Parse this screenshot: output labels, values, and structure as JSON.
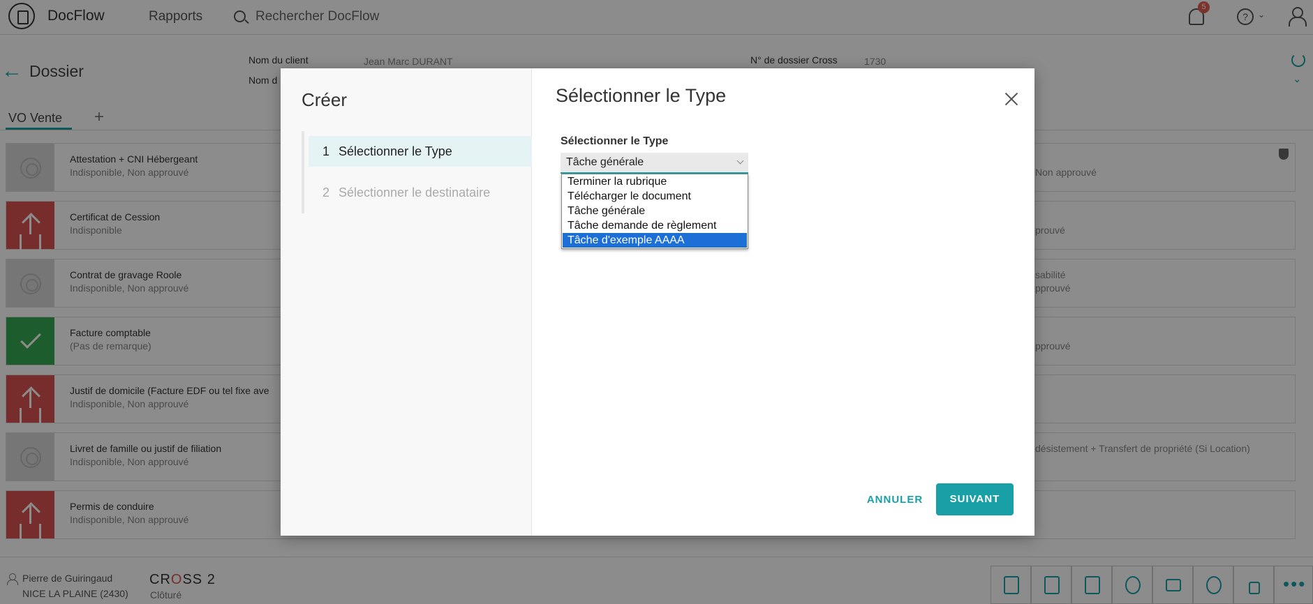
{
  "header": {
    "brand": "DocFlow",
    "nav_rapports": "Rapports",
    "search_placeholder": "Rechercher DocFlow",
    "notif_count": "5",
    "help": "?"
  },
  "dossier": {
    "title": "Dossier",
    "client_label": "Nom du client",
    "client_value": "Jean Marc DURANT",
    "second_label": "Nom d",
    "cross_label": "N° de dossier Cross",
    "cross_value": "1730"
  },
  "tabs": {
    "active": "VO Vente",
    "add": "+"
  },
  "rows": [
    {
      "title": "Attestation + CNI Hébergeant",
      "subtitle": "Indisponible, Non approuvé",
      "right": "Non approuvé"
    },
    {
      "title": "Certificat de Cession",
      "subtitle": "Indisponible",
      "right": "prouvé"
    },
    {
      "title": "Contrat de gravage Roole",
      "subtitle": "Indisponible, Non approuvé",
      "right": "sabilité",
      "right2": "pprouvé"
    },
    {
      "title": "Facture comptable",
      "subtitle": "(Pas de remarque)",
      "right": "pprouvé"
    },
    {
      "title": "Justif de domicile (Facture EDF ou tel fixe ave",
      "subtitle": "Indisponible, Non approuvé",
      "right": ""
    },
    {
      "title": "Livret de famille ou justif de filiation",
      "subtitle": "Indisponible, Non approuvé",
      "right": "désistement + Transfert de propriété (Si Location)"
    },
    {
      "title": "Permis de conduire",
      "subtitle": "Indisponible, Non approuvé",
      "right": ""
    }
  ],
  "footer": {
    "user_name": "Pierre de Guiringaud",
    "location": "NICE LA PLAINE (2430)",
    "cross_a": "CR",
    "cross_o": "O",
    "cross_b": "SS 2",
    "status": "Clôturé"
  },
  "modal": {
    "left_title": "Créer",
    "steps": [
      {
        "num": "1",
        "label": "Sélectionner le Type"
      },
      {
        "num": "2",
        "label": "Sélectionner le destinataire"
      }
    ],
    "title": "Sélectionner le Type",
    "field_label": "Sélectionner le Type",
    "selected_value": "Tâche générale",
    "options": [
      "Terminer la rubrique",
      "Télécharger le document",
      "Tâche générale",
      "Tâche demande de règlement",
      "Tâche d'exemple AAAA"
    ],
    "highlighted_option": "Tâche d'exemple AAAA",
    "cancel_label": "ANNULER",
    "next_label": "SUIVANT"
  },
  "colors": {
    "accent": "#19a0a6",
    "danger": "#d9534f",
    "success": "#35a853",
    "highlight": "#1b6fd6"
  }
}
